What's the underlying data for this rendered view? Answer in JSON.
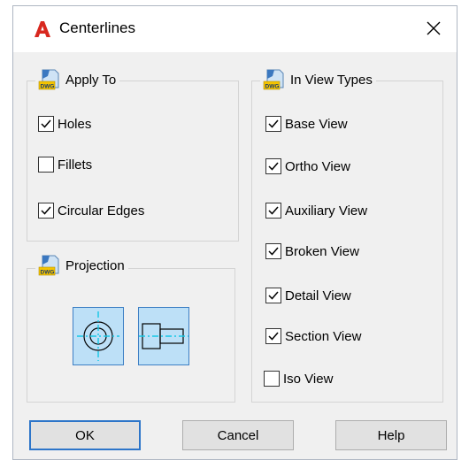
{
  "window": {
    "title": "Centerlines",
    "close_icon": "close-icon",
    "app_icon": "autodesk-a-icon",
    "accent": "#d8281f"
  },
  "apply_to": {
    "legend": "Apply To",
    "items": [
      {
        "label": "Holes",
        "checked": true
      },
      {
        "label": "Fillets",
        "checked": false
      },
      {
        "label": "Circular Edges",
        "checked": true
      }
    ]
  },
  "projection": {
    "legend": "Projection",
    "buttons": [
      {
        "name": "circular-projection",
        "selected": true
      },
      {
        "name": "axial-projection",
        "selected": true
      }
    ]
  },
  "view_types": {
    "legend": "In View Types",
    "items": [
      {
        "label": "Base View",
        "checked": true
      },
      {
        "label": "Ortho View",
        "checked": true
      },
      {
        "label": "Auxiliary View",
        "checked": true
      },
      {
        "label": "Broken View",
        "checked": true
      },
      {
        "label": "Detail View",
        "checked": true
      },
      {
        "label": "Section View",
        "checked": true
      },
      {
        "label": "Iso View",
        "checked": false
      }
    ]
  },
  "buttons": {
    "ok": "OK",
    "cancel": "Cancel",
    "help": "Help"
  }
}
